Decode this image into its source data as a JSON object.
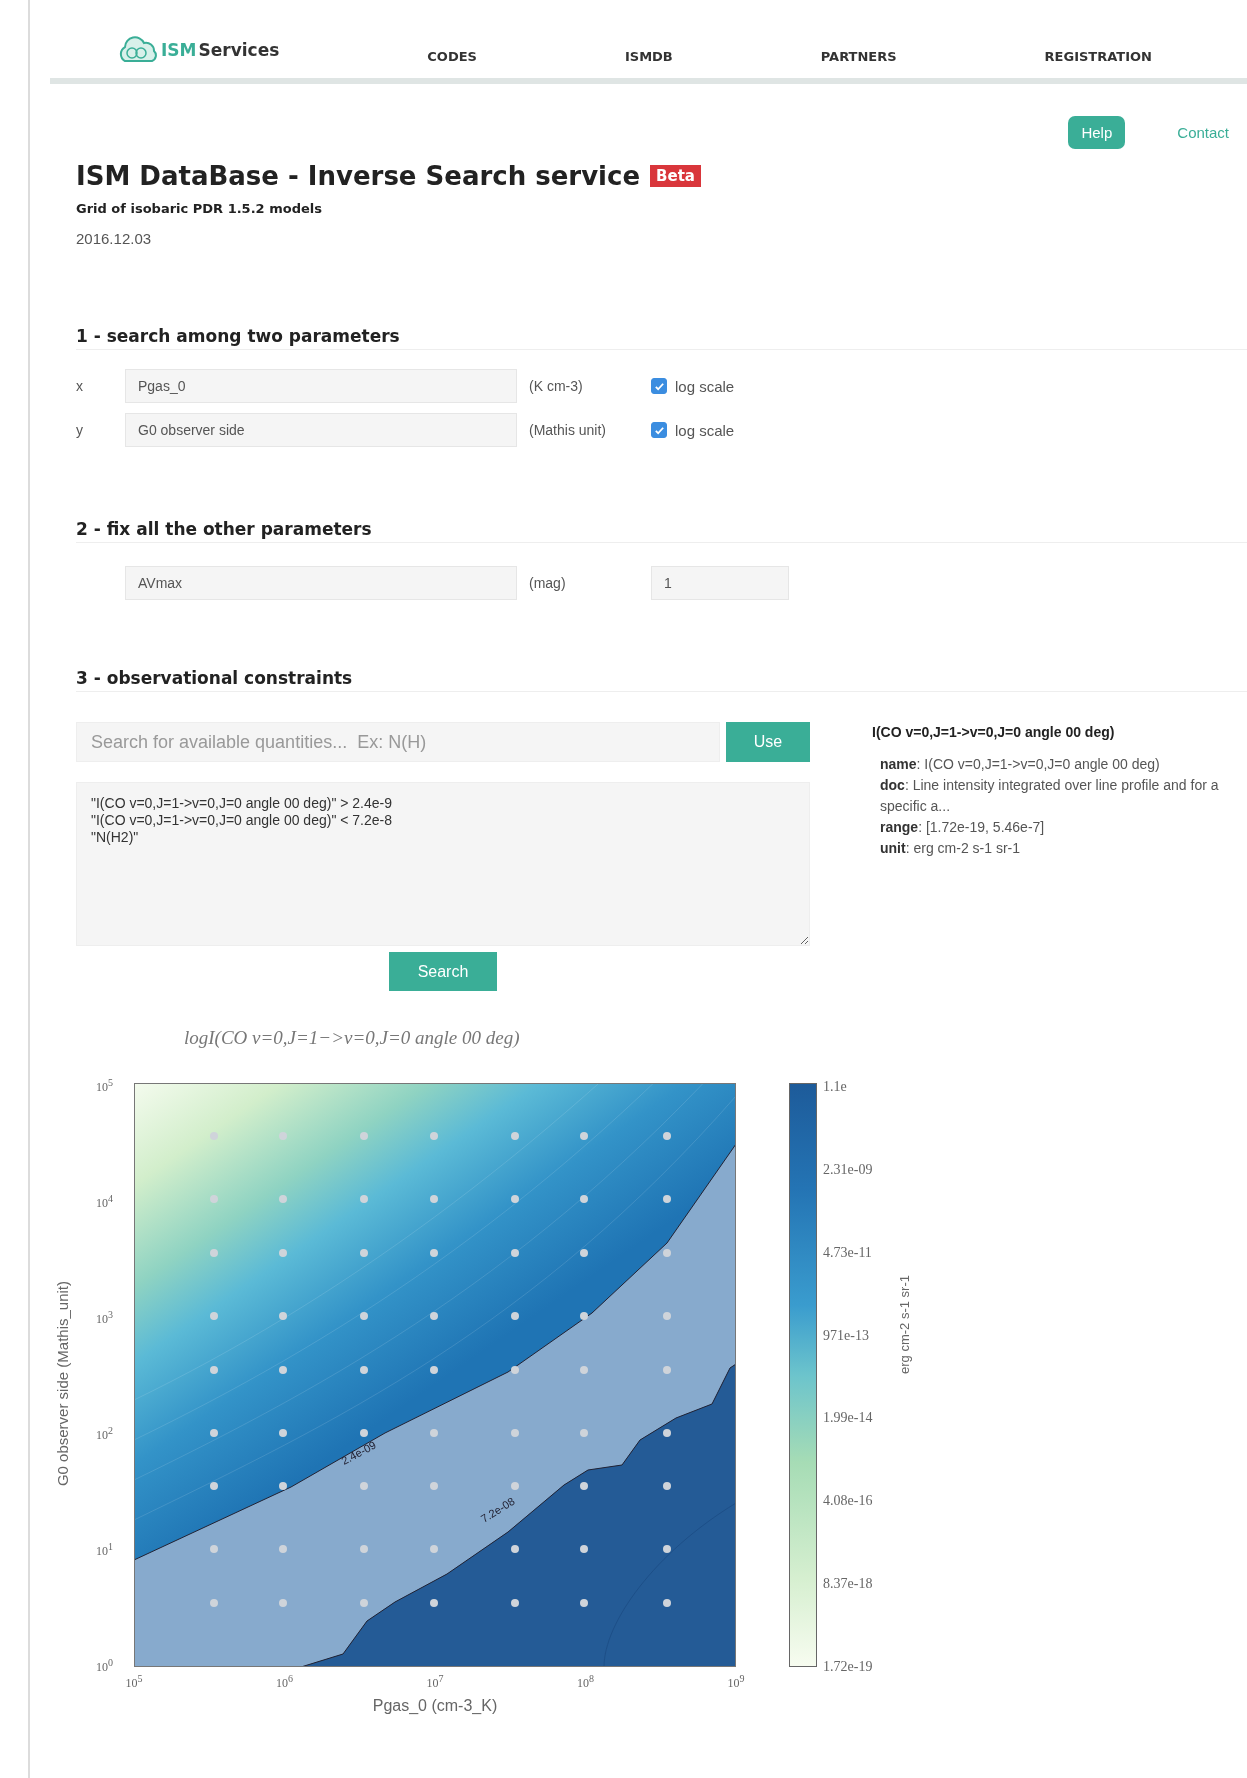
{
  "nav": {
    "logo": {
      "highlight": "ISM",
      "rest": "Services"
    },
    "items": [
      "CODES",
      "ISMDB",
      "PARTNERS",
      "REGISTRATION"
    ]
  },
  "header_links": [
    {
      "label": "Help",
      "kind": "button"
    },
    {
      "label": "Contact",
      "kind": "link"
    }
  ],
  "title": "ISM DataBase - Inverse Search service",
  "badge": "Beta",
  "subtitle": "Grid of isobaric PDR 1.5.2 models",
  "date": "2016.12.03",
  "section1": {
    "heading": "1 - search among two parameters",
    "rows": [
      {
        "axis": "x",
        "value": "Pgas_0",
        "unit": "(K cm-3)",
        "log_label": "log scale",
        "checked": true
      },
      {
        "axis": "y",
        "value": "G0 observer side",
        "unit": "(Mathis unit)",
        "log_label": "log scale",
        "checked": true
      }
    ]
  },
  "section2": {
    "heading": "2 - fix all the other parameters",
    "rows": [
      {
        "name": "AVmax",
        "unit": "(mag)",
        "value": "1"
      }
    ]
  },
  "section3": {
    "heading": "3 - observational constraints",
    "search": {
      "placeholder": "Search for available quantities...  Ex: N(H)"
    },
    "use_button": "Use",
    "constraints": "\"I(CO v=0,J=1->v=0,J=0 angle 00 deg)\" > 2.4e-9\n\"I(CO v=0,J=1->v=0,J=0 angle 00 deg)\" < 7.2e-8\n\"N(H2)\"",
    "search_button": "Search",
    "info": {
      "title": "I(CO v=0,J=1->v=0,J=0 angle 00 deg)",
      "fields": [
        "**name**: I(CO v=0,J=1->v=0,J=0 angle 00 deg)",
        "**doc**: Line intensity integrated over line profile and for a specific a...",
        "**range**: [1.72e-19, 5.46e-7]",
        "**unit**: erg cm-2 s-1 sr-1"
      ]
    }
  },
  "plot": {
    "title": "logI(CO v=0,J=1−>v=0,J=0 angle 00 deg)",
    "ylabel": "G0 observer side (Mathis_unit)",
    "xlabel": "Pgas_0 (cm-3_K)",
    "yticks": [
      "10$^{5}$",
      "10$^{4}$",
      "10$^{3}$",
      "10$^{2}$",
      "10$^{1}$",
      "10$^{0}$"
    ],
    "xticks": [
      "10$^{5}$",
      "10$^{6}$",
      "10$^{7}$",
      "10$^{8}$",
      "10$^{9}$"
    ],
    "contour_labels": [
      "2.4e-09",
      "7.2e-08"
    ],
    "colorbar": {
      "ticks": [
        "1.1e",
        "2.31e-09",
        "4.73e-11",
        "971e-13",
        "1.99e-14",
        "4.08e-16",
        "8.37e-18",
        "1.72e-19"
      ],
      "label": "erg cm-2 s-1 sr-1"
    }
  }
}
